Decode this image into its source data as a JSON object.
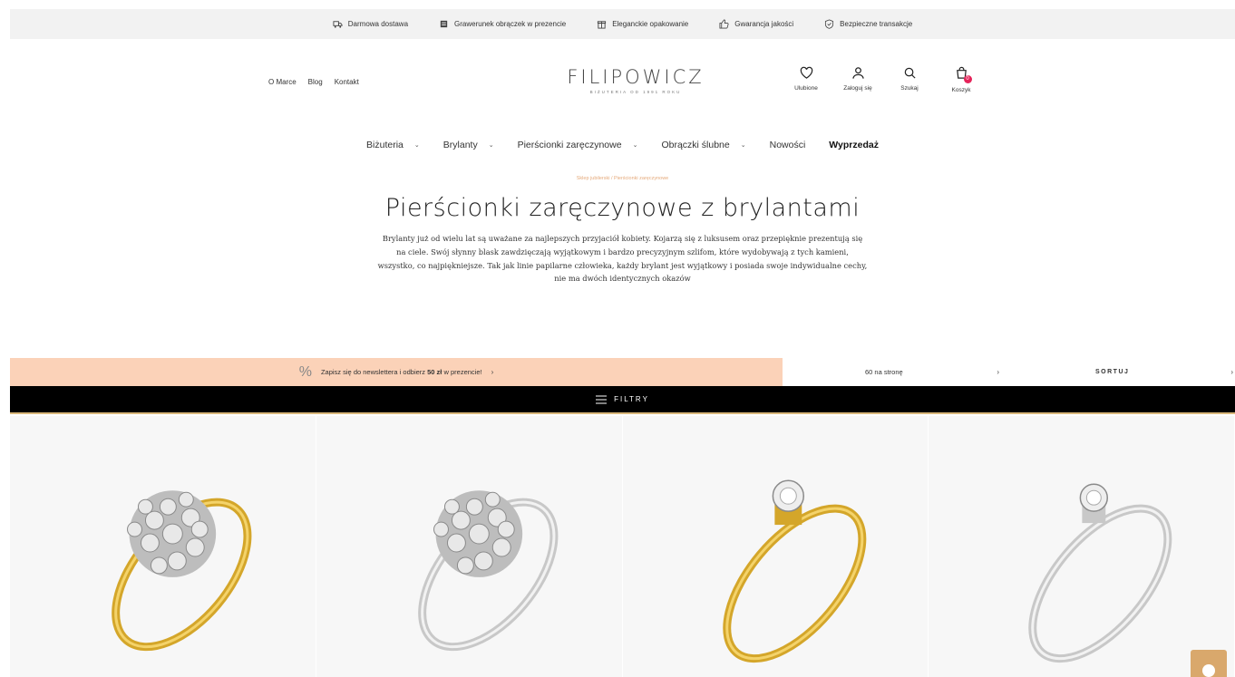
{
  "benefits": [
    {
      "icon": "truck-icon",
      "label": "Darmowa dostawa"
    },
    {
      "icon": "engraving-icon",
      "label": "Grawerunek obrączek w prezencie"
    },
    {
      "icon": "gift-box-icon",
      "label": "Eleganckie opakowanie"
    },
    {
      "icon": "thumbs-up-icon",
      "label": "Gwarancja jakości"
    },
    {
      "icon": "shield-icon",
      "label": "Bezpieczne transakcje"
    }
  ],
  "header": {
    "links": [
      "O Marce",
      "Blog",
      "Kontakt"
    ],
    "logo": "FILIPOWICZ",
    "logo_sub": "BIŻUTERIA OD 1991 ROKU",
    "actions": [
      {
        "icon": "heart-icon",
        "label": "Ulubione"
      },
      {
        "icon": "user-icon",
        "label": "Zaloguj się"
      },
      {
        "icon": "search-icon",
        "label": "Szukaj"
      },
      {
        "icon": "bag-icon",
        "label": "Koszyk"
      }
    ],
    "cart_count": "0"
  },
  "nav": {
    "items": [
      {
        "label": "Biżuteria",
        "has_dropdown": true
      },
      {
        "label": "Brylanty",
        "has_dropdown": true
      },
      {
        "label": "Pierścionki zaręczynowe",
        "has_dropdown": true
      },
      {
        "label": "Obrączki ślubne",
        "has_dropdown": true
      },
      {
        "label": "Nowości",
        "has_dropdown": false
      },
      {
        "label": "Wyprzedaż",
        "has_dropdown": false
      }
    ]
  },
  "hero": {
    "breadcrumb": "Sklep jubilerski / Pierścionki zaręczynowe",
    "title": "Pierścionki zaręczynowe z brylantami",
    "intro": "Brylanty już od wielu lat są uważane za najlepszych przyjaciół kobiety. Kojarzą się z luksusem oraz przepięknie prezentują się na ciele. Swój słynny blask zawdzięczają wyjątkowym i bardzo precyzyjnym szlifom, które wydobywają z tych kamieni, wszystko, co najpiękniejsze. Tak jak linie papilarne człowieka, każdy brylant jest wyjątkowy i posiada swoje indywidualne cechy, nie ma dwóch identycznych okazów"
  },
  "newsletter": {
    "icon": "percent-icon",
    "text_before": "Zapisz się do newslettera i odbierz",
    "amount": "50 zł",
    "text_after": "w prezencie!",
    "arrow": "›"
  },
  "options": {
    "per_page": "60 na stronę",
    "sort_label": "SORTUJ",
    "arrow": "›"
  },
  "filter": {
    "label": "FILTRY"
  },
  "products": [
    {
      "name": "yellow-gold-cluster-ring",
      "metal": "#d4a62a"
    },
    {
      "name": "white-gold-cluster-ring",
      "metal": "#cfcfcf"
    },
    {
      "name": "yellow-gold-solitaire-ring",
      "metal": "#d4a62a"
    },
    {
      "name": "white-gold-solitaire-ring",
      "metal": "#cfcfcf"
    }
  ],
  "colors": {
    "accent_peach": "#fbd2b8",
    "gold": "#d9b77a",
    "badge": "#e5245a"
  }
}
